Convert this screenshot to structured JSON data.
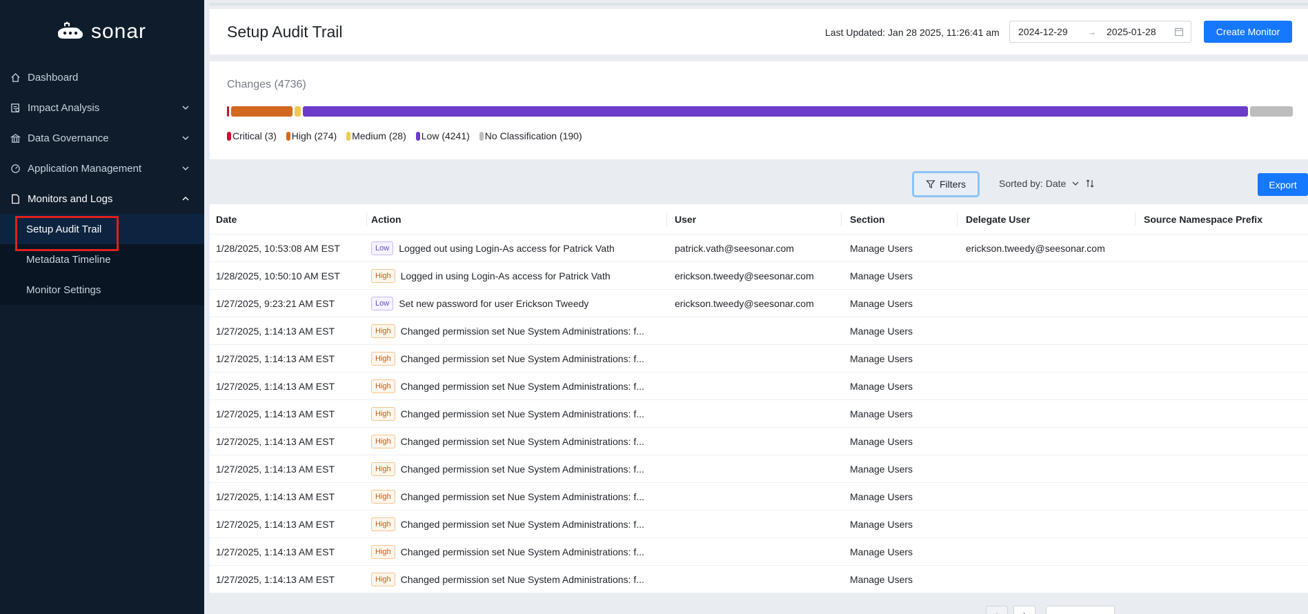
{
  "app": {
    "name": "sonar"
  },
  "colors": {
    "sidebar_bg": "#0f1c2c",
    "accent": "#1677ff",
    "active_highlight": "#e0201e"
  },
  "sidebar": {
    "items": [
      {
        "label": "Dashboard",
        "icon": "home-icon"
      },
      {
        "label": "Impact Analysis",
        "icon": "impact-icon"
      },
      {
        "label": "Data Governance",
        "icon": "bank-icon"
      },
      {
        "label": "Application Management",
        "icon": "dashboard-gauge-icon"
      },
      {
        "label": "Monitors and Logs",
        "icon": "file-icon"
      }
    ],
    "subitems": [
      {
        "label": "Setup Audit Trail"
      },
      {
        "label": "Metadata Timeline"
      },
      {
        "label": "Monitor Settings"
      }
    ]
  },
  "header": {
    "title": "Setup Audit Trail",
    "last_updated": "Last Updated: Jan 28 2025, 11:26:41 am",
    "date_start": "2024-12-29",
    "date_end": "2025-01-28",
    "date_arrow": "→",
    "create_label": "Create Monitor"
  },
  "changes": {
    "title": "Changes (4736)",
    "legend": [
      {
        "label": "Critical (3)",
        "color": "#c8102e",
        "count": 3
      },
      {
        "label": "High (274)",
        "color": "#d2691e",
        "count": 274
      },
      {
        "label": "Medium (28)",
        "color": "#f2c94c",
        "count": 28
      },
      {
        "label": "Low (4241)",
        "color": "#6a3cc9",
        "count": 4241
      },
      {
        "label": "No Classification (190)",
        "color": "#bdbdbd",
        "count": 190
      }
    ]
  },
  "toolbar": {
    "filters_label": "Filters",
    "sorted_label": "Sorted by: Date",
    "export_label": "Export"
  },
  "table": {
    "columns": [
      "Date",
      "Action",
      "User",
      "Section",
      "Delegate User",
      "Source Namespace Prefix"
    ],
    "rows": [
      {
        "date": "1/28/2025, 10:53:08 AM EST",
        "level": "Low",
        "action": "Logged out using Login-As access for Patrick Vath",
        "user": "patrick.vath@seesonar.com",
        "section": "Manage Users",
        "delegate": "erickson.tweedy@seesonar.com",
        "source": ""
      },
      {
        "date": "1/28/2025, 10:50:10 AM EST",
        "level": "High",
        "action": "Logged in using Login-As access for Patrick Vath",
        "user": "erickson.tweedy@seesonar.com",
        "section": "Manage Users",
        "delegate": "",
        "source": ""
      },
      {
        "date": "1/27/2025, 9:23:21 AM EST",
        "level": "Low",
        "action": "Set new password for user Erickson Tweedy",
        "user": "erickson.tweedy@seesonar.com",
        "section": "Manage Users",
        "delegate": "",
        "source": ""
      },
      {
        "date": "1/27/2025, 1:14:13 AM EST",
        "level": "High",
        "action": "Changed permission set Nue System Administrations: f...",
        "user": "",
        "section": "Manage Users",
        "delegate": "",
        "source": ""
      },
      {
        "date": "1/27/2025, 1:14:13 AM EST",
        "level": "High",
        "action": "Changed permission set Nue System Administrations: f...",
        "user": "",
        "section": "Manage Users",
        "delegate": "",
        "source": ""
      },
      {
        "date": "1/27/2025, 1:14:13 AM EST",
        "level": "High",
        "action": "Changed permission set Nue System Administrations: f...",
        "user": "",
        "section": "Manage Users",
        "delegate": "",
        "source": ""
      },
      {
        "date": "1/27/2025, 1:14:13 AM EST",
        "level": "High",
        "action": "Changed permission set Nue System Administrations: f...",
        "user": "",
        "section": "Manage Users",
        "delegate": "",
        "source": ""
      },
      {
        "date": "1/27/2025, 1:14:13 AM EST",
        "level": "High",
        "action": "Changed permission set Nue System Administrations: f...",
        "user": "",
        "section": "Manage Users",
        "delegate": "",
        "source": ""
      },
      {
        "date": "1/27/2025, 1:14:13 AM EST",
        "level": "High",
        "action": "Changed permission set Nue System Administrations: f...",
        "user": "",
        "section": "Manage Users",
        "delegate": "",
        "source": ""
      },
      {
        "date": "1/27/2025, 1:14:13 AM EST",
        "level": "High",
        "action": "Changed permission set Nue System Administrations: f...",
        "user": "",
        "section": "Manage Users",
        "delegate": "",
        "source": ""
      },
      {
        "date": "1/27/2025, 1:14:13 AM EST",
        "level": "High",
        "action": "Changed permission set Nue System Administrations: f...",
        "user": "",
        "section": "Manage Users",
        "delegate": "",
        "source": ""
      },
      {
        "date": "1/27/2025, 1:14:13 AM EST",
        "level": "High",
        "action": "Changed permission set Nue System Administrations: f...",
        "user": "",
        "section": "Manage Users",
        "delegate": "",
        "source": ""
      },
      {
        "date": "1/27/2025, 1:14:13 AM EST",
        "level": "High",
        "action": "Changed permission set Nue System Administrations: f...",
        "user": "",
        "section": "Manage Users",
        "delegate": "",
        "source": ""
      }
    ]
  }
}
